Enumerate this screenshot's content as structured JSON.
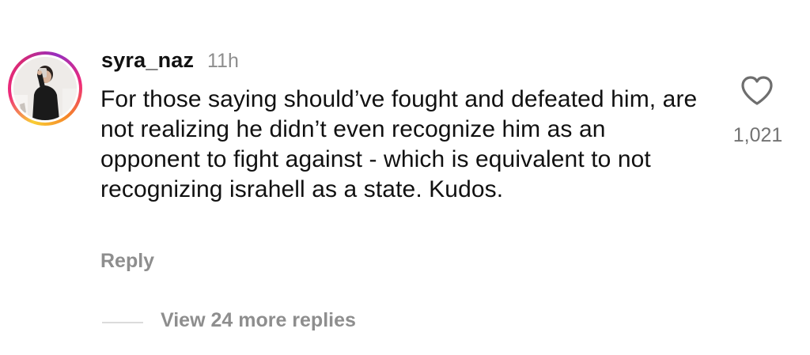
{
  "comment": {
    "username": "syra_naz",
    "timestamp": "11h",
    "text": "For those saying should’ve fought and defeated him, are not realizing he didn’t even recognize him as an opponent to fight against - which is equivalent to not recognizing israhell as a state. Kudos.",
    "reply_label": "Reply",
    "like_count": "1,021",
    "view_replies_label": "View 24 more replies"
  },
  "icons": {
    "like": "heart-icon",
    "avatar": "profile-photo"
  },
  "colors": {
    "primary_text": "#111111",
    "secondary_text": "#8e8e8e",
    "story_ring_start": "#f9ce34",
    "story_ring_mid": "#ee2a7b",
    "story_ring_end": "#962fbf"
  }
}
